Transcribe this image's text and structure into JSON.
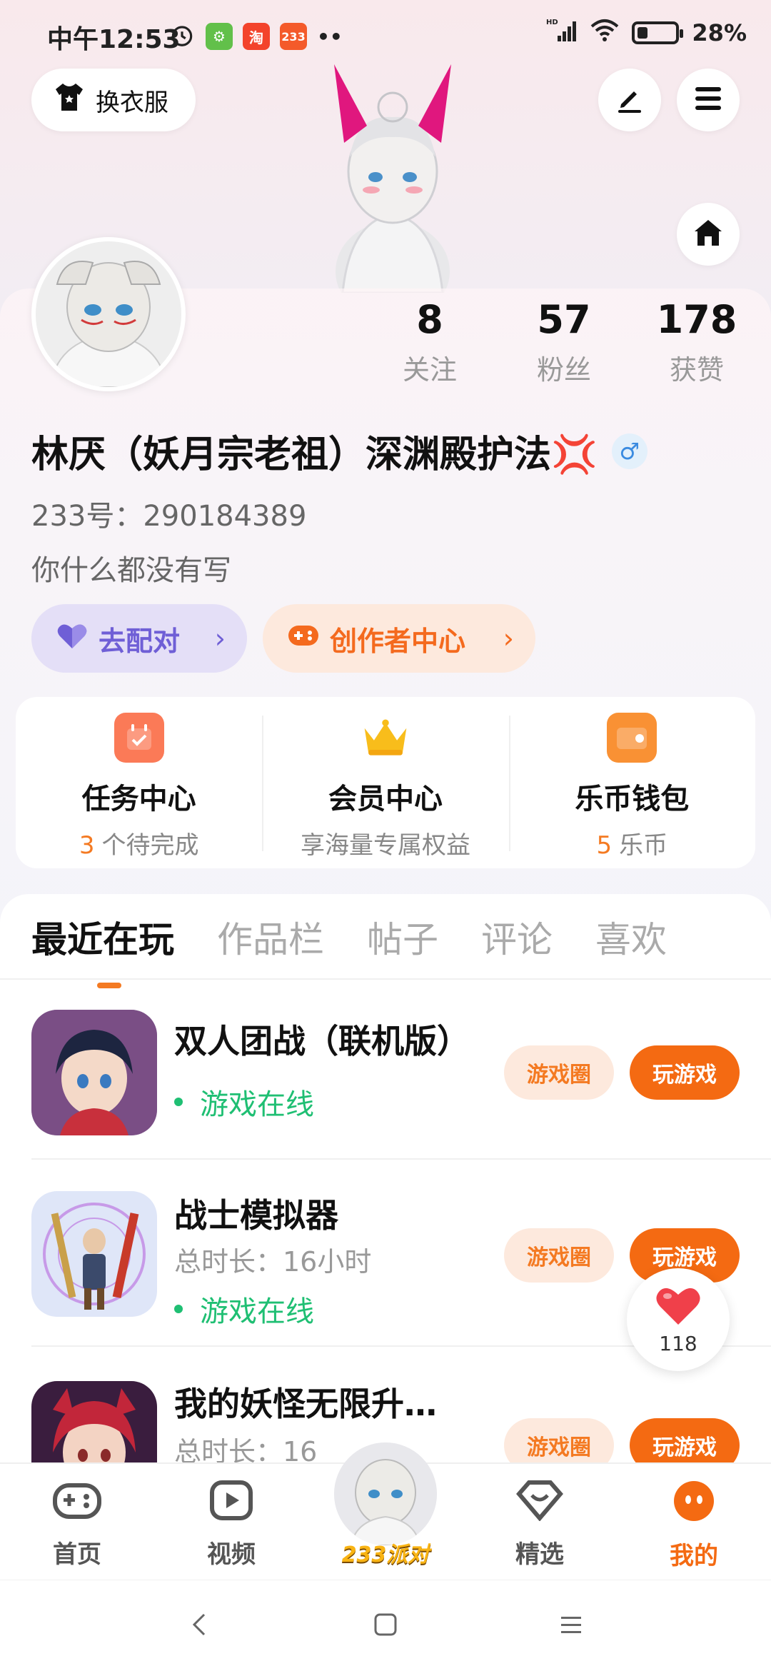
{
  "status_bar": {
    "time": "中午12:53",
    "app_badge_1": "淘",
    "app_badge_2": "233",
    "more_dots": "••",
    "hd_label": "HD",
    "battery_pct": "28%",
    "battery_level": 0.28
  },
  "header": {
    "outfit_label": "换衣服"
  },
  "profile": {
    "stats": [
      {
        "value": "8",
        "label": "关注"
      },
      {
        "value": "57",
        "label": "粉丝"
      },
      {
        "value": "178",
        "label": "获赞"
      }
    ],
    "nickname": "林厌（妖月宗老祖）深渊殿护法💢",
    "gender_symbol": "♂",
    "user_id": "233号：290184389",
    "bio": "你什么都没有写",
    "match_label": "去配对",
    "creator_label": "创作者中心"
  },
  "quick": [
    {
      "title": "任务中心",
      "highlight": "3",
      "sub": "个待完成"
    },
    {
      "title": "会员中心",
      "highlight": "",
      "sub": "享海量专属权益"
    },
    {
      "title": "乐币钱包",
      "highlight": "5",
      "sub": "乐币"
    }
  ],
  "tabs": [
    "最近在玩",
    "作品栏",
    "帖子",
    "评论",
    "喜欢"
  ],
  "games": [
    {
      "name": "双人团战（联机版）",
      "meta": "",
      "online": "游戏在线",
      "circle_btn": "游戏圈",
      "play_btn": "玩游戏"
    },
    {
      "name": "战士模拟器",
      "meta": "总时长：16小时",
      "online": "游戏在线",
      "circle_btn": "游戏圈",
      "play_btn": "玩游戏"
    },
    {
      "name": "我的妖怪无限升…",
      "meta": "总时长：16",
      "online": "",
      "circle_btn": "游戏圈",
      "play_btn": "玩游戏"
    }
  ],
  "like_count": "118",
  "bottom_nav": [
    {
      "label": "首页",
      "icon": "gamepad-icon"
    },
    {
      "label": "视频",
      "icon": "play-icon"
    },
    {
      "label": "233派对",
      "icon": "party-avatar"
    },
    {
      "label": "精选",
      "icon": "heart-diamond-icon"
    },
    {
      "label": "我的",
      "icon": "profile-face-icon"
    }
  ],
  "colors": {
    "accent": "#f46a12",
    "online": "#1fbf73",
    "match": "#6f5fd6"
  }
}
